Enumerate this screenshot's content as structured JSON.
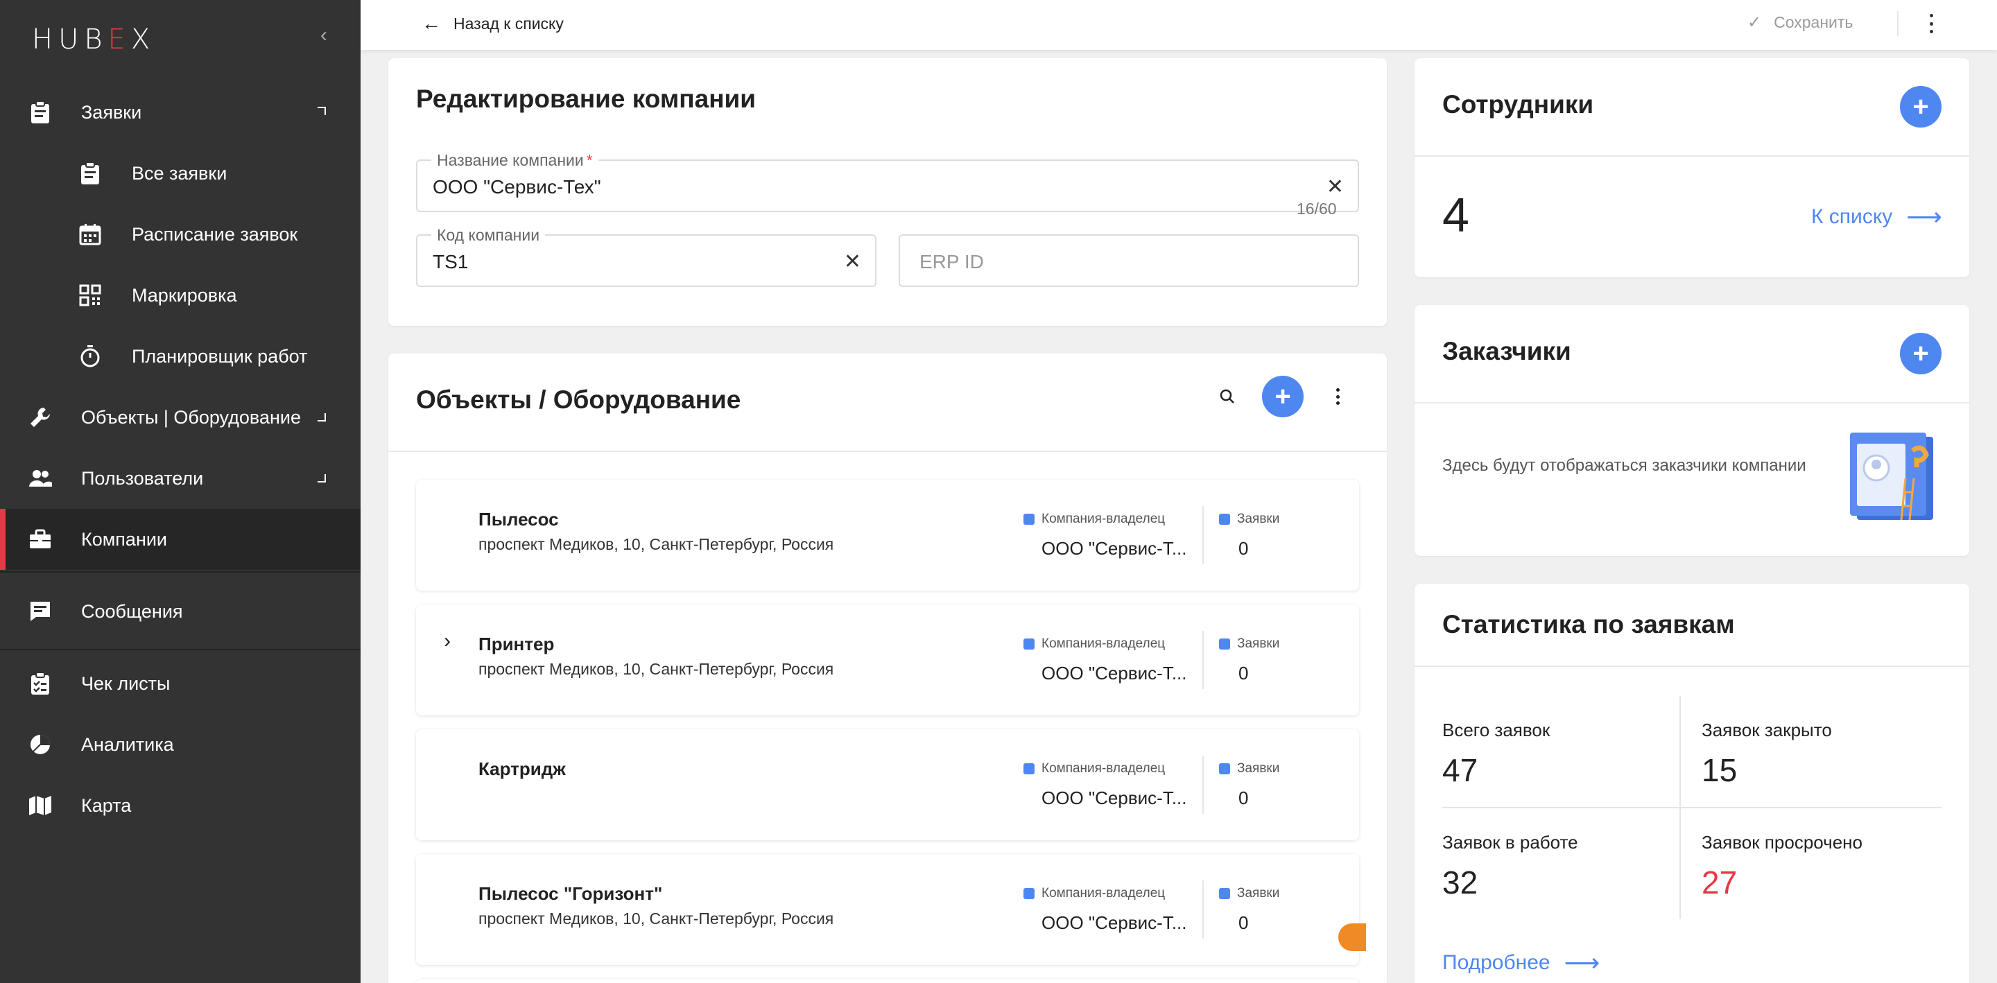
{
  "app": {
    "logo_main": "HUB",
    "logo_accent": "E",
    "logo_end": "X"
  },
  "sidebar": {
    "items": [
      {
        "label": "Заявки",
        "icon": "clipboard-icon"
      },
      {
        "label": "Все заявки",
        "icon": "clipboard-icon"
      },
      {
        "label": "Расписание заявок",
        "icon": "calendar-icon"
      },
      {
        "label": "Маркировка",
        "icon": "qr-code-icon"
      },
      {
        "label": "Планировщик работ",
        "icon": "stopwatch-icon"
      },
      {
        "label": "Объекты | Оборудование",
        "icon": "wrench-icon"
      },
      {
        "label": "Пользователи",
        "icon": "users-icon"
      },
      {
        "label": "Компании",
        "icon": "briefcase-icon"
      },
      {
        "label": "Сообщения",
        "icon": "chat-icon"
      },
      {
        "label": "Чек листы",
        "icon": "checklist-icon"
      },
      {
        "label": "Аналитика",
        "icon": "pie-chart-icon"
      },
      {
        "label": "Карта",
        "icon": "map-icon"
      }
    ]
  },
  "topbar": {
    "back_label": "Назад к списку",
    "save_label": "Сохранить"
  },
  "edit_company": {
    "title": "Редактирование компании",
    "name_label": "Название компании",
    "name_required": "*",
    "name_value": "ООО \"Сервис-Тех\"",
    "name_counter": "16/60",
    "code_label": "Код компании",
    "code_value": "TS1",
    "erp_placeholder": "ERP ID"
  },
  "objects": {
    "title": "Объекты / Оборудование",
    "owner_label": "Компания-владелец",
    "requests_label": "Заявки",
    "rows": [
      {
        "name": "Пылесос",
        "address": "проспект Медиков, 10, Санкт-Петербург, Россия",
        "owner": "ООО \"Сервис-Т...",
        "requests": "0"
      },
      {
        "name": "Принтер",
        "address": "проспект Медиков, 10, Санкт-Петербург, Россия",
        "owner": "ООО \"Сервис-Т...",
        "requests": "0"
      },
      {
        "name": "Картридж",
        "address": "",
        "owner": "ООО \"Сервис-Т...",
        "requests": "0"
      },
      {
        "name": "Пылесос \"Горизонт\"",
        "address": "проспект Медиков, 10, Санкт-Петербург, Россия",
        "owner": "ООО \"Сервис-Т...",
        "requests": "0"
      }
    ]
  },
  "employees": {
    "title": "Сотрудники",
    "count": "4",
    "link": "К списку"
  },
  "customers": {
    "title": "Заказчики",
    "empty_text": "Здесь будут отображаться заказчики компании"
  },
  "stats": {
    "title": "Статистика по заявкам",
    "total_label": "Всего заявок",
    "total_value": "47",
    "closed_label": "Заявок закрыто",
    "closed_value": "15",
    "in_work_label": "Заявок в работе",
    "in_work_value": "32",
    "overdue_label": "Заявок просрочено",
    "overdue_value": "27",
    "overdue_color": "#e53945",
    "more_link": "Подробнее"
  },
  "colors": {
    "accent": "#4f87f0",
    "brand_red": "#e53945",
    "sidebar_bg": "#333333"
  }
}
